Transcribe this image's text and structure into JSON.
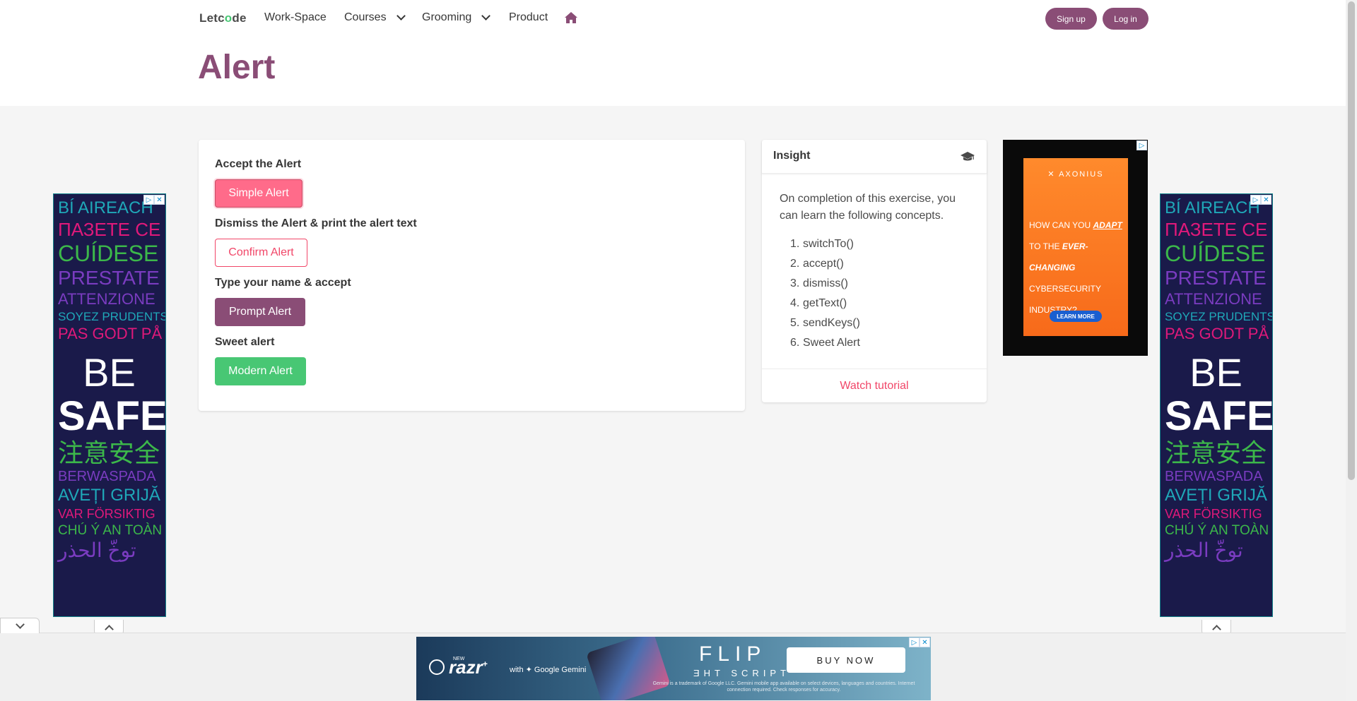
{
  "navbar": {
    "brand_let": "Let",
    "brand_c": "c",
    "brand_o": "o",
    "brand_de": "de",
    "items": [
      {
        "label": "Work-Space"
      },
      {
        "label": "Courses"
      },
      {
        "label": "Grooming"
      },
      {
        "label": "Product"
      }
    ],
    "signup_label": "Sign up",
    "login_label": "Log in"
  },
  "page": {
    "title": "Alert"
  },
  "exercise": {
    "sections": [
      {
        "label": "Accept the Alert",
        "button": "Simple Alert"
      },
      {
        "label": "Dismiss the Alert & print the alert text",
        "button": "Confirm Alert"
      },
      {
        "label": "Type your name & accept",
        "button": "Prompt Alert"
      },
      {
        "label": "Sweet alert",
        "button": "Modern Alert"
      }
    ]
  },
  "insight": {
    "title": "Insight",
    "intro": "On completion of this exercise, you can learn the following concepts.",
    "concepts": [
      "switchTo()",
      "accept()",
      "dismiss()",
      "getText()",
      "sendKeys()",
      "Sweet Alert"
    ],
    "footer_link": "Watch tutorial"
  },
  "ads": {
    "side_lines": [
      {
        "text": "BÍ AIREACH",
        "color": "#1fa8b8",
        "size": 24
      },
      {
        "text": "ПАЗЕТЕ СЕ",
        "color": "#e0197a",
        "size": 26
      },
      {
        "text": "CUÍDESE",
        "color": "#3cb84a",
        "size": 32
      },
      {
        "text": "PRESTATE",
        "color": "#7a3cc0",
        "size": 28
      },
      {
        "text": "ATTENZIONE",
        "color": "#7a3cc0",
        "size": 22
      },
      {
        "text": "SOYEZ PRUDENTS",
        "color": "#1fa8b8",
        "size": 17
      },
      {
        "text": "PAS GODT PÅ",
        "color": "#e0197a",
        "size": 22
      },
      {
        "text": "BE",
        "color": "#ffffff",
        "size": 56
      },
      {
        "text": "SAFE",
        "color": "#ffffff",
        "size": 58
      },
      {
        "text": "注意安全",
        "color": "#3cb84a",
        "size": 36
      },
      {
        "text": "BERWASPADA",
        "color": "#7a3cc0",
        "size": 20
      },
      {
        "text": "AVEȚI GRIJĂ",
        "color": "#1fa8b8",
        "size": 24
      },
      {
        "text": "VAR FÖRSIKTIG",
        "color": "#e0197a",
        "size": 18
      },
      {
        "text": "CHÚ Ý AN TOÀN",
        "color": "#3cb84a",
        "size": 19
      },
      {
        "text": "توخّ الحذر",
        "color": "#7a3cc0",
        "size": 28
      }
    ],
    "axonius": {
      "logo": "AXONIUS",
      "copy_1": "HOW CAN YOU",
      "copy_1b": "ADAPT",
      "copy_2": "TO THE",
      "copy_2b": "EVER-CHANGING",
      "copy_3": "CYBERSECURITY",
      "copy_4": "INDUSTRY?",
      "button": "LEARN MORE"
    },
    "bottom": {
      "new": "NEW",
      "brand": "razr",
      "plus": "+",
      "gemini": "with ✦ Google Gemini",
      "flip": "FLIP",
      "script": "ƎHT SCRIPT",
      "buy": "BUY NOW",
      "fine": "Gemini is a trademark of Google LLC. Gemini mobile app available on select devices, languages and countries. Internet connection required. Check responses for accuracy."
    }
  },
  "colors": {
    "brand_purple": "#8a4d76",
    "danger_pink": "#f14668",
    "success_green": "#48c774"
  }
}
